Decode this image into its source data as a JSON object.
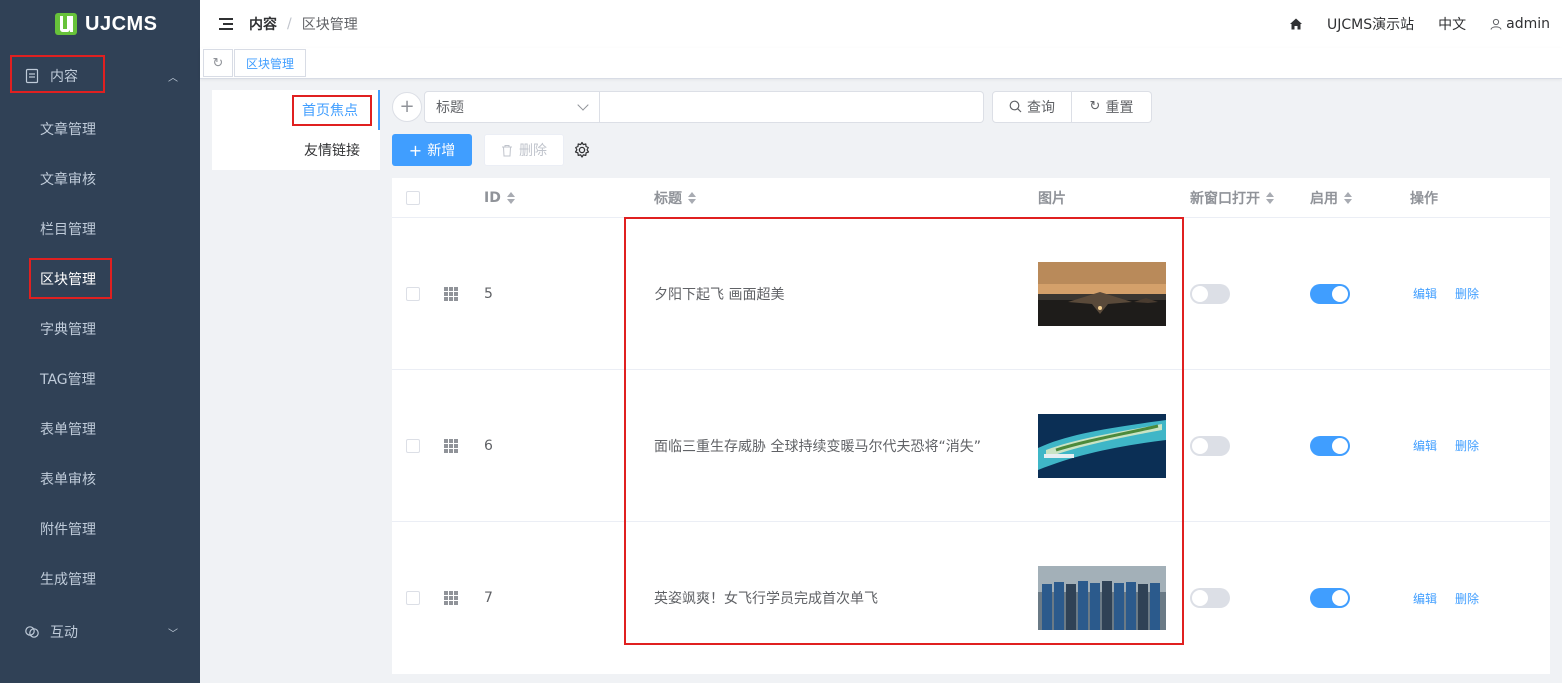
{
  "app": {
    "brand": "UJCMS"
  },
  "sidebar": {
    "groups": [
      {
        "label": "内容",
        "icon": "document-icon",
        "expanded": true
      },
      {
        "label": "互动",
        "icon": "interact-icon",
        "expanded": false
      }
    ],
    "items": [
      {
        "label": "文章管理"
      },
      {
        "label": "文章审核"
      },
      {
        "label": "栏目管理"
      },
      {
        "label": "区块管理",
        "active": true
      },
      {
        "label": "字典管理"
      },
      {
        "label": "TAG管理"
      },
      {
        "label": "表单管理"
      },
      {
        "label": "表单审核"
      },
      {
        "label": "附件管理"
      },
      {
        "label": "生成管理"
      }
    ]
  },
  "header": {
    "breadcrumb": [
      "内容",
      "区块管理"
    ],
    "site": "UJCMS演示站",
    "language": "中文",
    "user": "admin"
  },
  "tags": {
    "active": "区块管理"
  },
  "left_panel": {
    "items": [
      {
        "label": "首页焦点",
        "active": true
      },
      {
        "label": "友情链接",
        "active": false
      }
    ]
  },
  "search": {
    "field": "标题",
    "input_value": "",
    "query_label": "查询",
    "reset_label": "重置"
  },
  "actions": {
    "add_label": "新增",
    "delete_label": "删除"
  },
  "table": {
    "columns": {
      "id": "ID",
      "title": "标题",
      "image": "图片",
      "new_window": "新窗口打开",
      "enabled": "启用",
      "ops": "操作"
    },
    "rows": [
      {
        "id": "5",
        "title": "夕阳下起飞 画面超美",
        "new_window": false,
        "enabled": true,
        "thumb_colors": [
          "#3a3631",
          "#d4a06a",
          "#9a6a3a",
          "#1e1c1a"
        ]
      },
      {
        "id": "6",
        "title": "面临三重生存威胁 全球持续变暖马尔代夫恐将“消失”",
        "new_window": false,
        "enabled": true,
        "thumb_colors": [
          "#10436b",
          "#3fb6c7",
          "#c9e3c4",
          "#0b2f55"
        ]
      },
      {
        "id": "7",
        "title": "英姿飒爽！女飞行学员完成首次单飞",
        "new_window": false,
        "enabled": true,
        "thumb_colors": [
          "#6a7a86",
          "#2b5a8c",
          "#a3b0b8",
          "#2f4256"
        ]
      }
    ],
    "edit_label": "编辑",
    "delete_label": "删除"
  },
  "colors": {
    "primary": "#409eff",
    "sidebar_bg": "#304156",
    "highlight": "#e02020"
  }
}
